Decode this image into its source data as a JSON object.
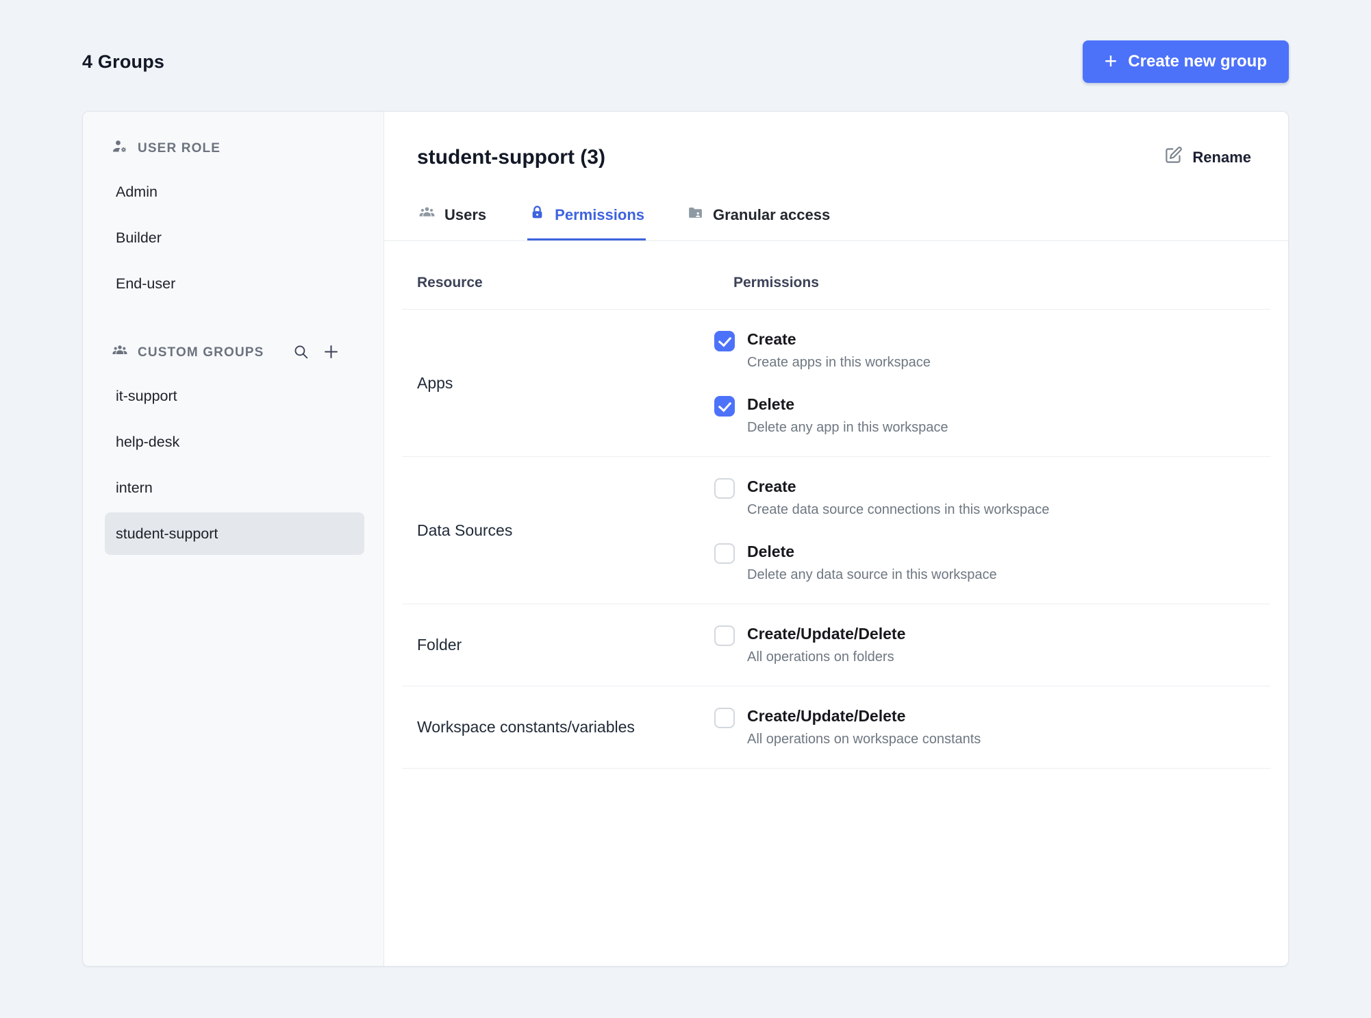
{
  "page": {
    "title": "4 Groups",
    "create_group_plus": "+",
    "create_group_button": "Create new group"
  },
  "sidebar": {
    "user_role_header": "USER ROLE",
    "user_roles": [
      "Admin",
      "Builder",
      "End-user"
    ],
    "custom_groups_header": "CUSTOM GROUPS",
    "custom_groups": [
      "it-support",
      "help-desk",
      "intern",
      "student-support"
    ],
    "selected_group": "student-support",
    "icons": [
      "user-role-icon",
      "custom-groups-icon",
      "search-icon",
      "add-group-icon"
    ]
  },
  "content": {
    "title": "student-support (3)",
    "rename_button": "Rename",
    "active_tab": "Permissions",
    "tabs": [
      {
        "label": "Users",
        "icon": "users-icon"
      },
      {
        "label": "Permissions",
        "icon": "lock-icon"
      },
      {
        "label": "Granular access",
        "icon": "folder-icon"
      }
    ],
    "table": {
      "headers": {
        "resource": "Resource",
        "permissions": "Permissions"
      },
      "rows": [
        {
          "resource": "Apps",
          "permissions": [
            {
              "label": "Create",
              "description": "Create apps in this workspace",
              "checked": true
            },
            {
              "label": "Delete",
              "description": "Delete any app in this workspace",
              "checked": true
            }
          ]
        },
        {
          "resource": "Data Sources",
          "permissions": [
            {
              "label": "Create",
              "description": "Create data source connections in this workspace",
              "checked": false
            },
            {
              "label": "Delete",
              "description": "Delete any data source in this workspace",
              "checked": false
            }
          ]
        },
        {
          "resource": "Folder",
          "permissions": [
            {
              "label": "Create/Update/Delete",
              "description": "All operations on folders",
              "checked": false
            }
          ]
        },
        {
          "resource": "Workspace constants/variables",
          "permissions": [
            {
              "label": "Create/Update/Delete",
              "description": "All operations on workspace constants",
              "checked": false
            }
          ]
        }
      ]
    }
  },
  "colors": {
    "primary": "#4d72fa",
    "active_tab": "#3e63dd",
    "selected_item_bg": "#e4e7eb",
    "page_background": "#f0f4f8"
  }
}
